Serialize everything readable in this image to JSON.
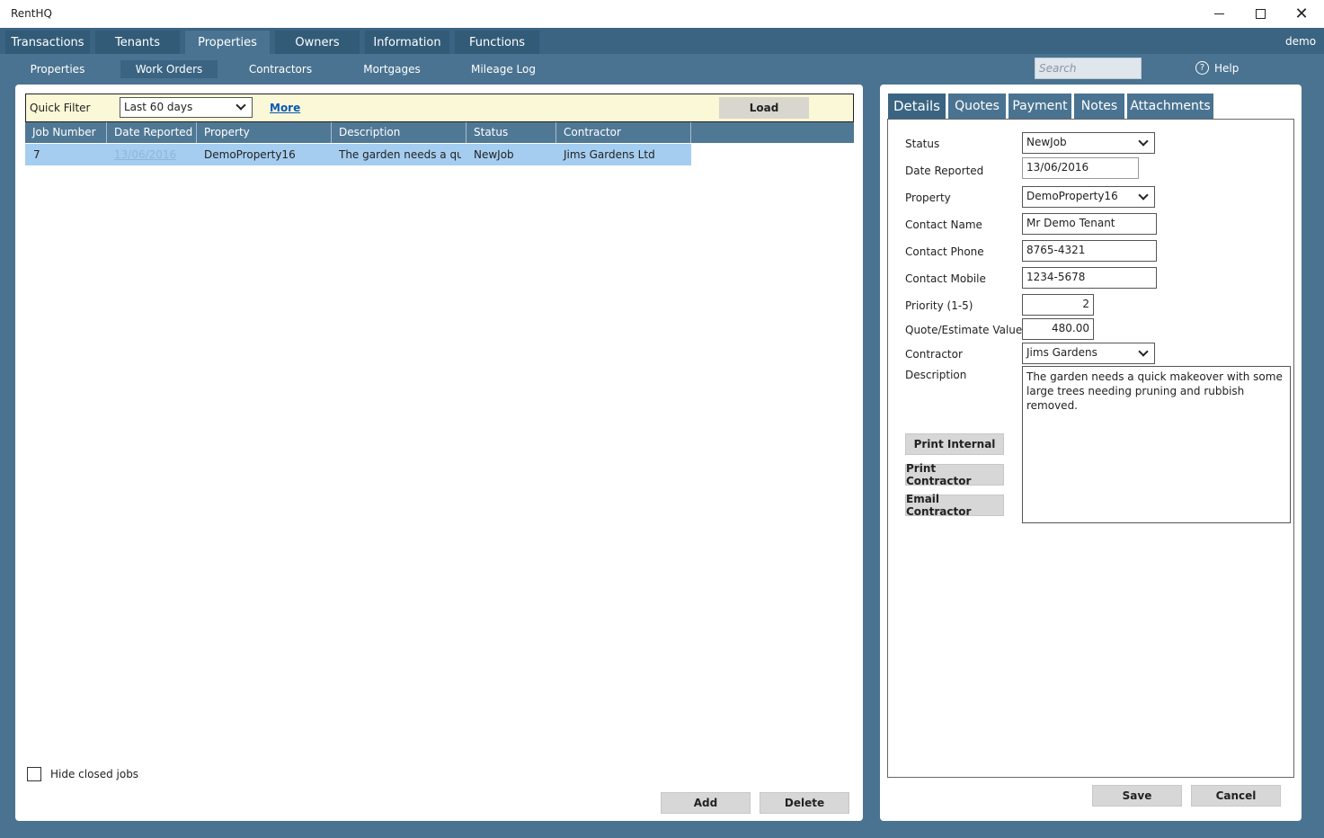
{
  "window": {
    "title": "RentHQ",
    "user": "demo"
  },
  "main_tabs": [
    "Transactions",
    "Tenants",
    "Properties",
    "Owners",
    "Information",
    "Functions"
  ],
  "sub_tabs": [
    "Properties",
    "Work Orders",
    "Contractors",
    "Mortgages",
    "Mileage Log"
  ],
  "search": {
    "placeholder": "Search"
  },
  "help_label": "Help",
  "quick_filter": {
    "label": "Quick Filter",
    "selected": "Last 60 days",
    "more_label": "More",
    "load_label": "Load"
  },
  "grid": {
    "columns": [
      "Job Number",
      "Date Reported",
      "Property",
      "Description",
      "Status",
      "Contractor"
    ],
    "rows": [
      {
        "job_number": "7",
        "date_reported": "13/06/2016",
        "property": "DemoProperty16",
        "description": "The garden needs a quick",
        "status": "NewJob",
        "contractor": "Jims Gardens Ltd"
      }
    ]
  },
  "hide_closed_label": "Hide closed jobs",
  "list_buttons": {
    "add": "Add",
    "delete": "Delete"
  },
  "detail_tabs": [
    "Details",
    "Quotes",
    "Payment",
    "Notes",
    "Attachments"
  ],
  "details": {
    "labels": {
      "status": "Status",
      "date_reported": "Date Reported",
      "property": "Property",
      "contact_name": "Contact Name",
      "contact_phone": "Contact Phone",
      "contact_mobile": "Contact Mobile",
      "priority": "Priority (1-5)",
      "quote_value": "Quote/Estimate Value",
      "contractor": "Contractor",
      "description": "Description"
    },
    "values": {
      "status": "NewJob",
      "date_reported": "13/06/2016",
      "property": "DemoProperty16",
      "contact_name": "Mr Demo Tenant",
      "contact_phone": "8765-4321",
      "contact_mobile": "1234-5678",
      "priority": "2",
      "quote_value": "480.00",
      "contractor": "Jims Gardens",
      "description": "The garden needs a quick makeover with some large trees needing pruning and rubbish removed."
    },
    "buttons": {
      "print_internal": "Print Internal",
      "print_contractor": "Print Contractor",
      "email_contractor": "Email Contractor"
    }
  },
  "footer_buttons": {
    "save": "Save",
    "cancel": "Cancel"
  }
}
